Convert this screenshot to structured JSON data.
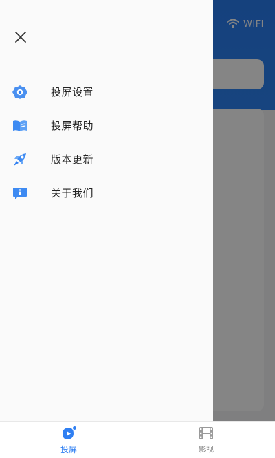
{
  "status": {
    "wifi_label": "WIFI"
  },
  "drawer": {
    "menu": [
      {
        "label": "投屏设置",
        "icon": "settings-icon"
      },
      {
        "label": "投屏帮助",
        "icon": "book-icon"
      },
      {
        "label": "版本更新",
        "icon": "rocket-icon"
      },
      {
        "label": "关于我们",
        "icon": "info-icon"
      }
    ]
  },
  "tabbar": {
    "tabs": [
      {
        "label": "投屏",
        "icon": "cast-play-icon",
        "active": true
      },
      {
        "label": "影视",
        "icon": "film-icon",
        "active": false
      }
    ]
  },
  "colors": {
    "accent": "#2f7ff2",
    "header_blue": "#2a7df0",
    "inactive_text": "#8d8d8d"
  }
}
